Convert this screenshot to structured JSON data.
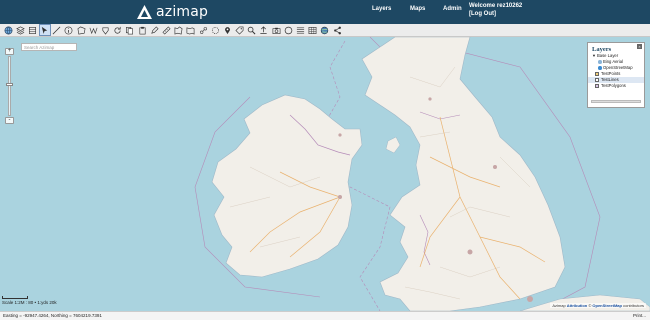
{
  "header": {
    "brand": "azimap",
    "nav": [
      "Layers",
      "Maps",
      "Admin"
    ],
    "welcome_line": "Welcome rez10262",
    "logout": "[Log Out]",
    "colors": {
      "bar": "#1e4863",
      "text": "#ffffff"
    }
  },
  "toolbar": {
    "tools": [
      "globe-icon",
      "layers-icon",
      "stack-icon",
      "pointer-icon",
      "line-icon",
      "info-icon",
      "polygon-icon",
      "measure-icon",
      "shape-icon",
      "refresh-icon",
      "copy-icon",
      "paste-icon",
      "pencil-icon",
      "ruler-icon",
      "select-area-icon",
      "filter-icon",
      "route-icon",
      "zoom-box-icon",
      "marker-icon",
      "tag-icon",
      "search-icon",
      "upload-icon",
      "camera-icon",
      "circle-icon",
      "list-icon",
      "table-icon",
      "globe-print-icon",
      "share-icon"
    ],
    "active_tool": "pointer-icon"
  },
  "map": {
    "search_placeholder": "Search Azimap",
    "zoom_in": "+",
    "zoom_out": "-",
    "scale_text": "Scale 1:2M : 80 • 1:yds 20k",
    "attribution_prefix": "Azimap",
    "attribution_link1": "Attribution",
    "attribution_link2": "OpenStreetMap",
    "attribution_suffix": "contributors",
    "colors": {
      "sea": "#aad3df",
      "land": "#f2efe9",
      "border": "#b58bb8"
    }
  },
  "layers_panel": {
    "title": "Layers",
    "rows": [
      {
        "label": "Base Layer",
        "kind": "group"
      },
      {
        "label": "Bing Aerial",
        "kind": "radio",
        "color": "#8ab4d8"
      },
      {
        "label": "OpenStreetMap",
        "kind": "radio",
        "color": "#3a8ad0"
      },
      {
        "label": "TestPoints",
        "kind": "check"
      },
      {
        "label": "TestLines",
        "kind": "check",
        "selected": true
      },
      {
        "label": "TestPolygons",
        "kind": "check"
      }
    ]
  },
  "status": {
    "coordinates": "Easting = -92947.4264, Northing = 7604219.7391",
    "print_label": "Print..."
  }
}
